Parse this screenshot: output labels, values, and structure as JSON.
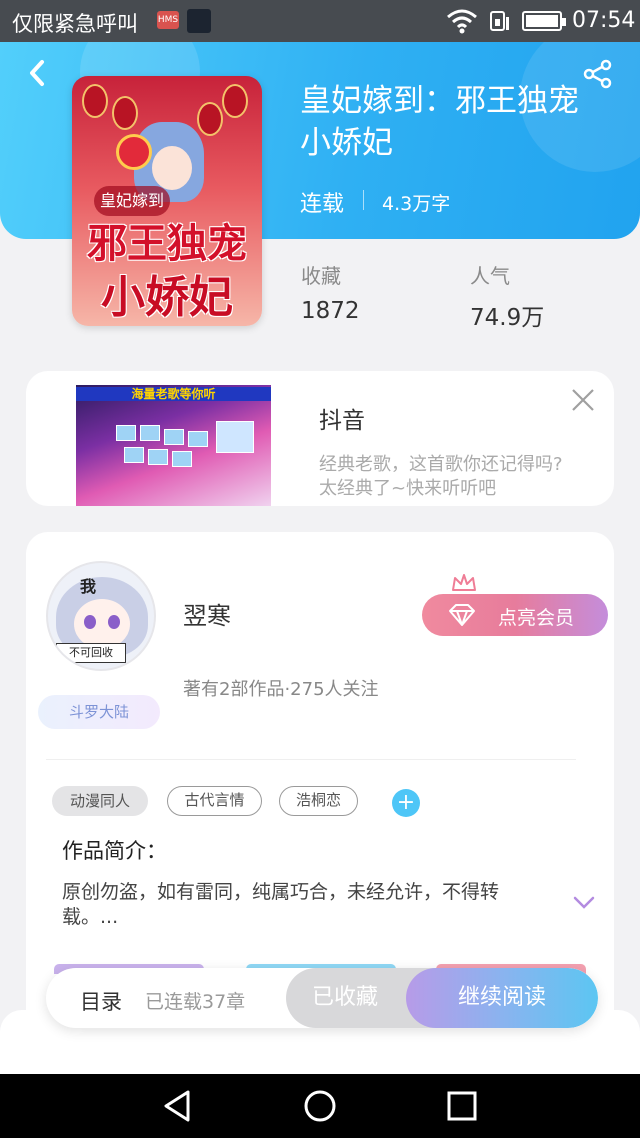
{
  "status_bar": {
    "carrier": "仅限紧急呼叫",
    "hms_badge": "HMS",
    "time": "07:54",
    "icons": [
      "wifi-icon",
      "sim-icon",
      "battery-icon"
    ]
  },
  "header": {
    "back_icon": "back-arrow-icon",
    "share_icon": "share-icon"
  },
  "book": {
    "title": "皇妃嫁到：邪王独宠小娇妃",
    "status": "连载",
    "word_count": "4.3万字",
    "cover": {
      "tag": "皇妃嫁到",
      "line1": "邪王独宠",
      "line2": "小娇妃"
    },
    "stats": [
      {
        "label": "收藏",
        "value": "1872"
      },
      {
        "label": "人气",
        "value": "74.9万"
      }
    ]
  },
  "ad": {
    "image_banner": "海量老歌等你听",
    "title": "抖音",
    "description_line1": "经典老歌，这首歌你还记得吗?",
    "description_line2": "太经典了~快来听听吧",
    "close_icon": "close-icon"
  },
  "author": {
    "avatar_text_top": "我",
    "avatar_sign": "不可回收",
    "badge": "斗罗大陆",
    "name": "翌寒",
    "meta": "著有2部作品·275人关注",
    "vip_button": "点亮会员",
    "tags": [
      "动漫同人",
      "古代言情",
      "浩桐恋"
    ],
    "add_tag_icon": "plus-icon",
    "intro_label": "作品简介：",
    "intro_text": "原创勿盗，如有雷同，纯属巧合，未经允许，不得转载。..."
  },
  "action_bar": {
    "toc_label": "目录",
    "chapters": "已连载37章",
    "collected_label": "已收藏",
    "read_label": "继续阅读"
  },
  "nav_bar": {
    "icons": [
      "back-triangle-icon",
      "home-circle-icon",
      "recents-square-icon"
    ]
  },
  "colors": {
    "header_blue": "#2fb0f3",
    "vip_pink": "#f08a9e",
    "read_gradient_start": "#b79be8",
    "read_gradient_end": "#5cc6f2"
  }
}
